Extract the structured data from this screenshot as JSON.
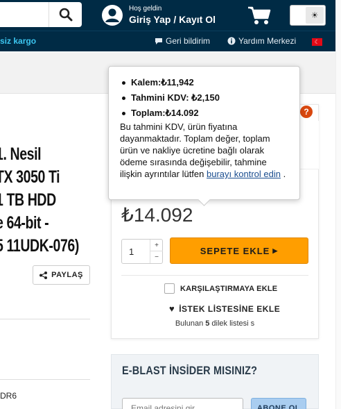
{
  "header": {
    "greeting": "Hoş geldin",
    "login_label": "Giriş Yap / Kayıt Ol",
    "theme_icon": "☀"
  },
  "subbar": {
    "cargo_text": "siz kargo",
    "feedback_label": "Geri bildirim",
    "help_label": "Yardım Merkezi"
  },
  "product": {
    "title_lines": [
      "1. Nesil",
      "TX 3050 Ti",
      "1 TB HDD",
      "e 64-bit -",
      "5 11UDK-076)"
    ],
    "share_label": "PAYLAŞ",
    "spec_text": "DR6"
  },
  "tooltip": {
    "items": [
      {
        "label": "Kalem:",
        "value": "₺11,942"
      },
      {
        "label": "Tahmini KDV: ",
        "value": "₺2,150"
      },
      {
        "label": "Toplam:",
        "value": "₺14.092"
      }
    ],
    "note_text": "Bu tahmini KDV, ürün fiyatına dayanmaktadır. Toplam değer, toplam ürün ve nakliye ücretine bağlı olarak ödeme sırasında değişebilir, tahmine ilişkin ayrıntılar lütfen ",
    "note_link": "burayı kontrol edin",
    "note_end": " ."
  },
  "buy": {
    "help_badge": "?",
    "price": "₺14.092",
    "quantity": "1",
    "qty_up": "+",
    "qty_down": "−",
    "add_to_cart": "SEPETE EKLE",
    "compare_label": "KARŞILAŞTIRMAYA EKLE",
    "wishlist_label": "İSTEK LİSTESİNE EKLE",
    "found_prefix": "Bulunan ",
    "found_count": "5",
    "found_suffix": " dilek listesi s"
  },
  "newsletter": {
    "title": "E-BLAST İNSİDER MISINIZ?",
    "email_placeholder": "Email adresini gir",
    "subscribe_label": "ABONE OL"
  },
  "colors": {
    "header_bg": "#002b45",
    "accent_cyan": "#3cc6f0",
    "cart_button": "#ff9e00",
    "help_badge": "#d9480f"
  }
}
